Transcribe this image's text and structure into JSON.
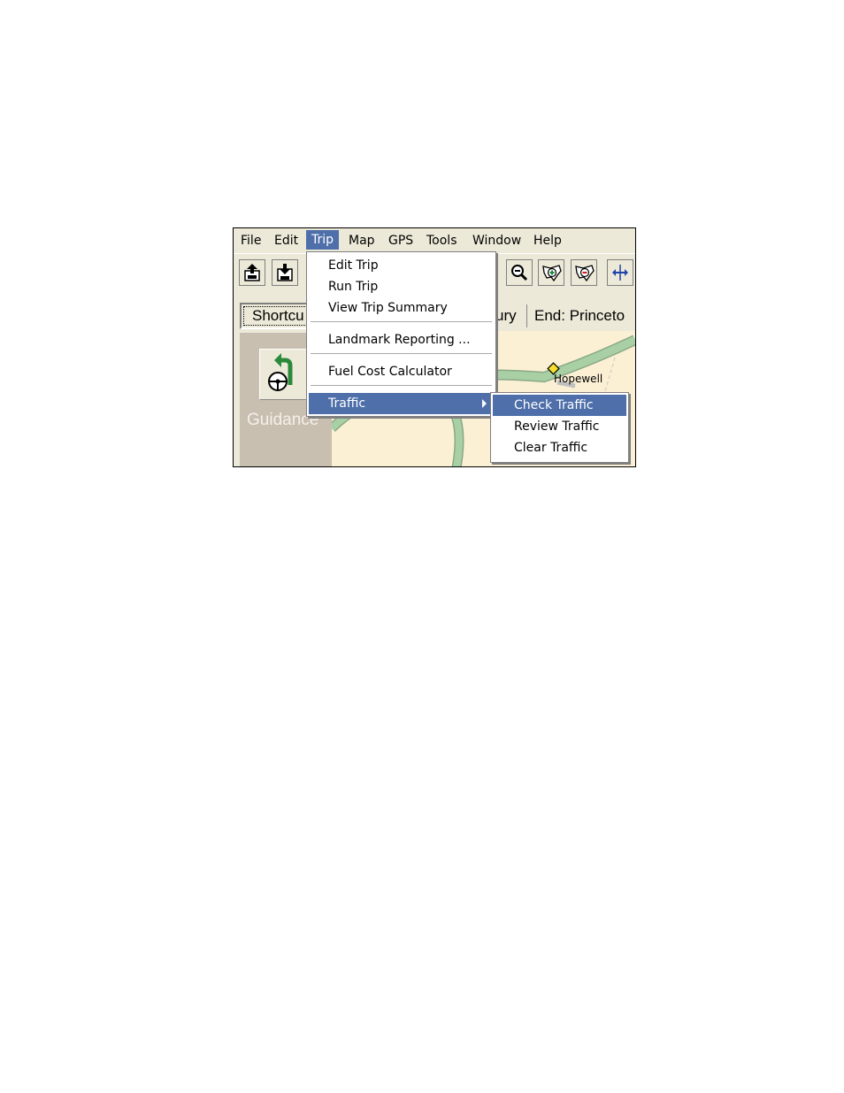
{
  "menubar": {
    "items": [
      {
        "label": "File"
      },
      {
        "label": "Edit"
      },
      {
        "label": "Trip"
      },
      {
        "label": "Map"
      },
      {
        "label": "GPS"
      },
      {
        "label": "Tools"
      },
      {
        "label": "Window"
      },
      {
        "label": "Help"
      }
    ],
    "active": "Trip"
  },
  "toolbar": {
    "icons": [
      "upload-icon",
      "download-icon",
      "zoom-out-icon",
      "zoom-in-us-map-icon",
      "zoom-out-us-map-icon",
      "pan-arrows-icon"
    ]
  },
  "shortcut_tab": {
    "label": "Shortcu"
  },
  "guidance": {
    "label": "Guidance",
    "icon": "steering-wheel-turn-icon"
  },
  "route_tabs": {
    "tab1": "ury",
    "tab2": "End: Princeto"
  },
  "map": {
    "city_label": "Hopewell"
  },
  "trip_menu": {
    "items": [
      {
        "label": "Edit Trip"
      },
      {
        "label": "Run Trip"
      },
      {
        "label": "View Trip Summary"
      },
      {
        "label": "Landmark Reporting ..."
      },
      {
        "label": "Fuel Cost Calculator"
      },
      {
        "label": "Traffic"
      }
    ],
    "highlighted": "Traffic"
  },
  "traffic_submenu": {
    "items": [
      {
        "label": "Check Traffic"
      },
      {
        "label": "Review Traffic"
      },
      {
        "label": "Clear Traffic"
      }
    ],
    "highlighted": "Check Traffic"
  },
  "colors": {
    "highlight": "#4e6fa9",
    "road": "#9cc49a",
    "map_bg": "#fbf0d4",
    "panel": "#c8bfb0"
  }
}
